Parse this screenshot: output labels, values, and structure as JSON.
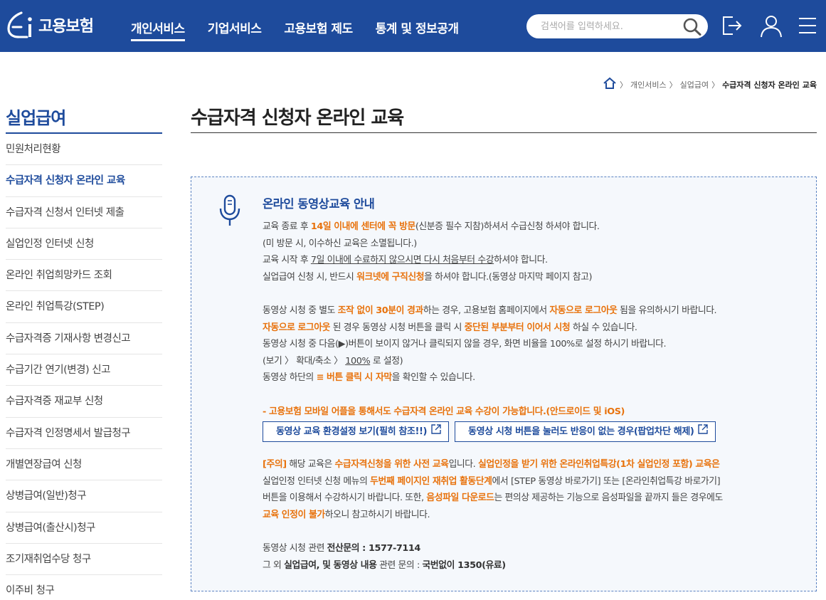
{
  "header": {
    "logo_text": "고용보험",
    "nav": [
      "개인서비스",
      "기업서비스",
      "고용보험 제도",
      "통계 및 정보공개"
    ],
    "search_placeholder": "검색어를 입력하세요.",
    "icons": [
      "search-icon",
      "logout-icon",
      "user-icon",
      "menu-icon"
    ],
    "colors": {
      "brand": "#1e4b9c",
      "accent": "#e8720c"
    }
  },
  "breadcrumb": {
    "items": [
      "개인서비스",
      "실업급여"
    ],
    "current": "수급자격 신청자 온라인 교육"
  },
  "sidebar": {
    "title": "실업급여",
    "items": [
      "민원처리현황",
      "수급자격 신청자 온라인 교육",
      "수급자격 신청서 인터넷 제출",
      "실업인정 인터넷 신청",
      "온라인 취업희망카드 조회",
      "온라인 취업특강(STEP)",
      "수급자격증 기재사항 변경신고",
      "수급기간 연기(변경) 신고",
      "수급자격증 재교부 신청",
      "수급자격 인정명세서 발급청구",
      "개별연장급여 신청",
      "상병급여(일반)청구",
      "상병급여(출산시)청구",
      "조기재취업수당 청구",
      "이주비 청구"
    ]
  },
  "main": {
    "title": "수급자격 신청자 온라인 교육",
    "box": {
      "title": "온라인 동영상교육 안내",
      "p1": {
        "a": "교육 종료 후 ",
        "b": "14일 이내에 센터에 꼭 방문",
        "c": "(신분증 필수 지참)하셔서 수급신청 하셔야 합니다."
      },
      "p2": "(미 방문 시, 이수하신 교육은 소멸됩니다.)",
      "p3": {
        "a": "교육 시작 후 ",
        "b": "7일 이내에 수료하지 않으시면 다시 처음부터 수강",
        "c": "하셔야 합니다."
      },
      "p4": {
        "a": "실업급여 신청 시, 반드시 ",
        "b": "워크넷에 구직신청",
        "c": "을 하셔야 합니다.(동영상 마지막 페이지 참고)"
      },
      "p5": {
        "a": "동영상 시청 중 별도 ",
        "b": "조작 없이 30분이 경과",
        "c": "하는 경우, 고용보험 홈페이지에서 ",
        "d": "자동으로 로그아웃",
        "e": " 됨을 유의하시기 바랍니다."
      },
      "p6": {
        "a": "자동으로 로그아웃",
        "b": " 된 경우 동영상 시청 버튼을 클릭 시 ",
        "c": "중단된 부분부터 이어서 시청",
        "d": " 하실 수 있습니다."
      },
      "p7": "동영상 시청 중 다음(▶)버튼이 보이지 않거나 클릭되지 않을 경우, 화면 비율을 100%로 설정 하시기 바랍니다.",
      "p8": {
        "a": "(보기 〉 확대/축소 〉 ",
        "b": "100%",
        "c": " 로 설정)"
      },
      "p9": {
        "a": "동영상 하단의 ",
        "b": "≡ 버튼 클릭 시 자막",
        "c": "을 확인할 수 있습니다."
      },
      "mobile_note": "- 고용보험 모바일 어플을 통해서도 수급자격 온라인 교육 수강이 가능합니다.(안드로이드 및 iOS)",
      "buttons": [
        "동영상 교육 환경설정 보기(필히 참조!!)",
        "동영상 시청 버튼을 눌러도 반응이 없는 경우(팝업차단 해제)"
      ],
      "notice": {
        "l1a": "[주의]",
        "l1b": " 해당 교육은 ",
        "l1c": "수급자격신청을 위한 사전 교육",
        "l1d": "입니다. ",
        "l1e": "실업인정을 받기 위한 온라인취업특강(1차 실업인정 포함) 교육은",
        "l2a": "실업인정 인터넷 신청 메뉴의 ",
        "l2b": "두번째 페이지인 재취업 활동단계",
        "l2c": "에서 [STEP 동영상 바로가기] 또는 [온라인취업특강 바로가기]",
        "l3a": "버튼을 이용해서 수강하시기 바랍니다. 또한, ",
        "l3b": "음성파일 다운로드",
        "l3c": "는 편의상 제공하는 기능으로 음성파일을 끝까지 들은 경우에도",
        "l4a": "교육 인정이 불가",
        "l4b": "하오니 참고하시기 바랍니다."
      },
      "contact1": {
        "a": "동영상 시청 관련 ",
        "b": "전산문의 : 1577-7114"
      },
      "contact2": {
        "a": "그 외 ",
        "b": "실업급여, 및 동영상 내용",
        "c": " 관련 문의 : ",
        "d": "국번없이 1350(유료)"
      }
    }
  }
}
